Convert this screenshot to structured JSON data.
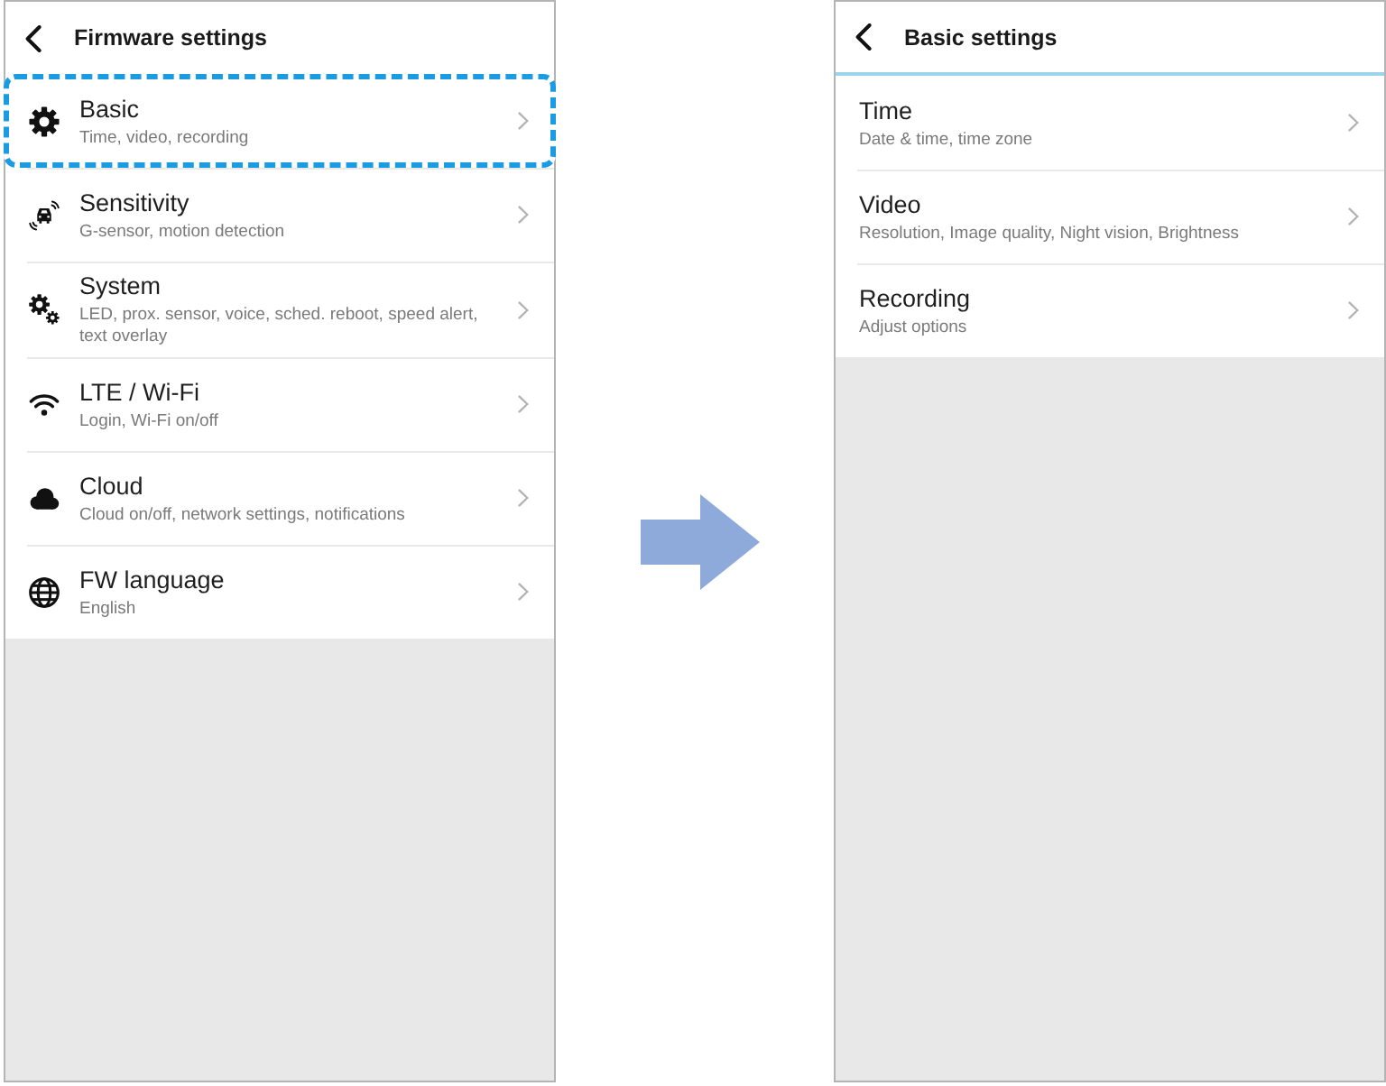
{
  "screens": [
    {
      "title": "Firmware settings",
      "accent_line": false,
      "items": [
        {
          "kind": "gear",
          "label": "Basic",
          "detail": "Time, video, recording",
          "highlighted": true
        },
        {
          "kind": "car-sensor",
          "label": "Sensitivity",
          "detail": "G-sensor, motion detection",
          "highlighted": false
        },
        {
          "kind": "gears",
          "label": "System",
          "detail": "LED, prox. sensor, voice, sched. reboot, speed alert, text overlay",
          "highlighted": false
        },
        {
          "kind": "wifi",
          "label": "LTE / Wi-Fi",
          "detail": "Login, Wi-Fi on/off",
          "highlighted": false
        },
        {
          "kind": "cloud",
          "label": "Cloud",
          "detail": "Cloud on/off, network settings, notifications",
          "highlighted": false
        },
        {
          "kind": "globe",
          "label": "FW language",
          "detail": "English",
          "highlighted": false
        }
      ]
    },
    {
      "title": "Basic settings",
      "accent_line": true,
      "items": [
        {
          "kind": "plain",
          "label": "Time",
          "detail": "Date & time, time zone",
          "highlighted": false
        },
        {
          "kind": "plain",
          "label": "Video",
          "detail": "Resolution, Image quality, Night vision, Brightness",
          "highlighted": false
        },
        {
          "kind": "plain",
          "label": "Recording",
          "detail": "Adjust options",
          "highlighted": false
        }
      ]
    }
  ]
}
